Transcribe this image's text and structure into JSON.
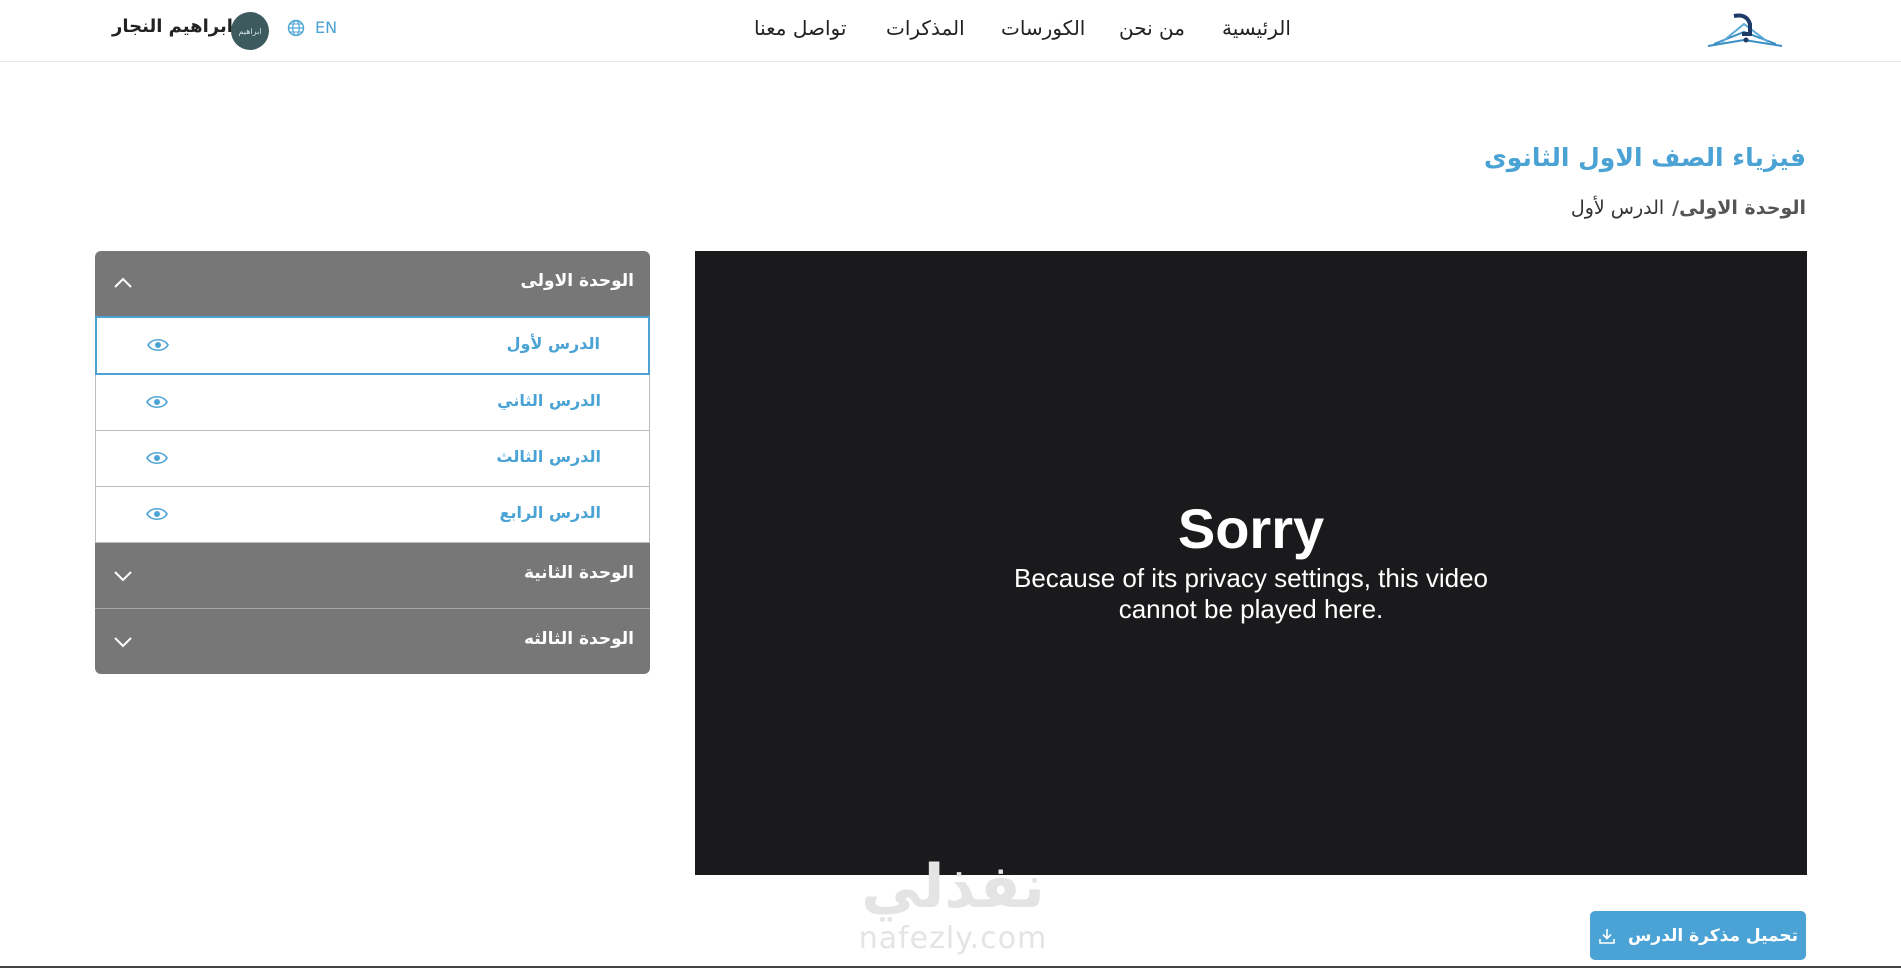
{
  "header": {
    "nav": [
      "الرئيسية",
      "من نحن",
      "الكورسات",
      "المذكرات",
      "تواصل معنا"
    ],
    "user_name": "ابراهيم النجار",
    "avatar_text": "ابراهيم",
    "lang_label": "EN"
  },
  "page": {
    "title": "فيزياء الصف الاول الثانوى",
    "breadcrumb_unit": "الوحدة الاولى/",
    "breadcrumb_lesson": "الدرس لأول"
  },
  "video": {
    "sorry": "Sorry",
    "message": "Because of its privacy settings, this video cannot be played here."
  },
  "download_label": "تحميل مذكرة الدرس",
  "accordion": {
    "units": [
      {
        "title": "الوحدة الاولى",
        "expanded": true,
        "lessons": [
          "الدرس لأول",
          "الدرس الثاني",
          "الدرس الثالث",
          "الدرس الرابع"
        ],
        "active_lesson": 0
      },
      {
        "title": "الوحدة الثانية",
        "expanded": false
      },
      {
        "title": "الوحدة الثالثه",
        "expanded": false
      }
    ]
  },
  "watermark": {
    "arabic": "نفذلي",
    "latin": "nafezly.com"
  },
  "colors": {
    "accent": "#4aa3d4",
    "accordion_header": "#777777",
    "video_bg": "#1a1a1c"
  }
}
